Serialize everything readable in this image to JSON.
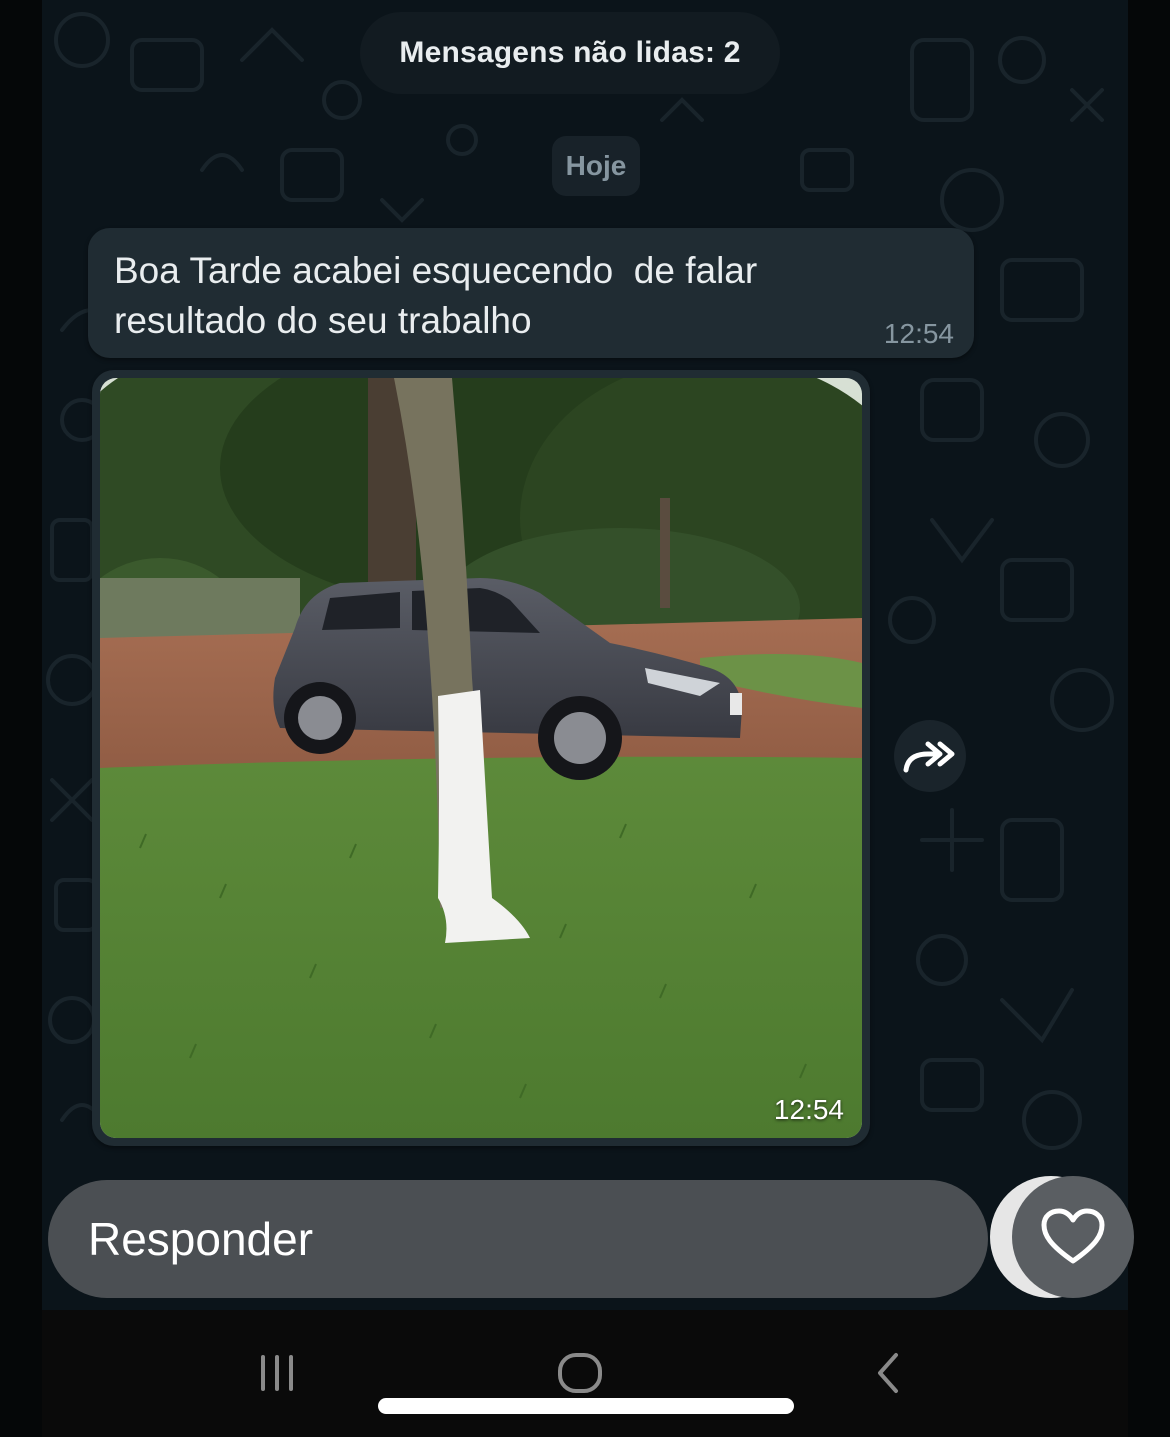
{
  "chat": {
    "unread_banner": "Mensagens não lidas: 2",
    "date_chip": "Hoje",
    "messages": [
      {
        "type": "text",
        "text": "Boa Tarde acabei esquecendo  de falar\nresultado do seu trabalho",
        "time": "12:54"
      },
      {
        "type": "image",
        "image_description_icon": "photo-car-under-tree",
        "time": "12:54"
      }
    ],
    "forward_icon": "forward-icon"
  },
  "reply": {
    "placeholder": "Responder",
    "like_icon": "heart-icon"
  },
  "navigation": {
    "recent_icon": "recent-apps-icon",
    "home_icon": "home-icon",
    "back_icon": "back-icon"
  },
  "colors": {
    "chat_background": "#0b141a",
    "bubble": "#202c33",
    "reply_bar": "#4b4f53",
    "text_primary": "#e9edef",
    "text_secondary": "#8696a0"
  }
}
